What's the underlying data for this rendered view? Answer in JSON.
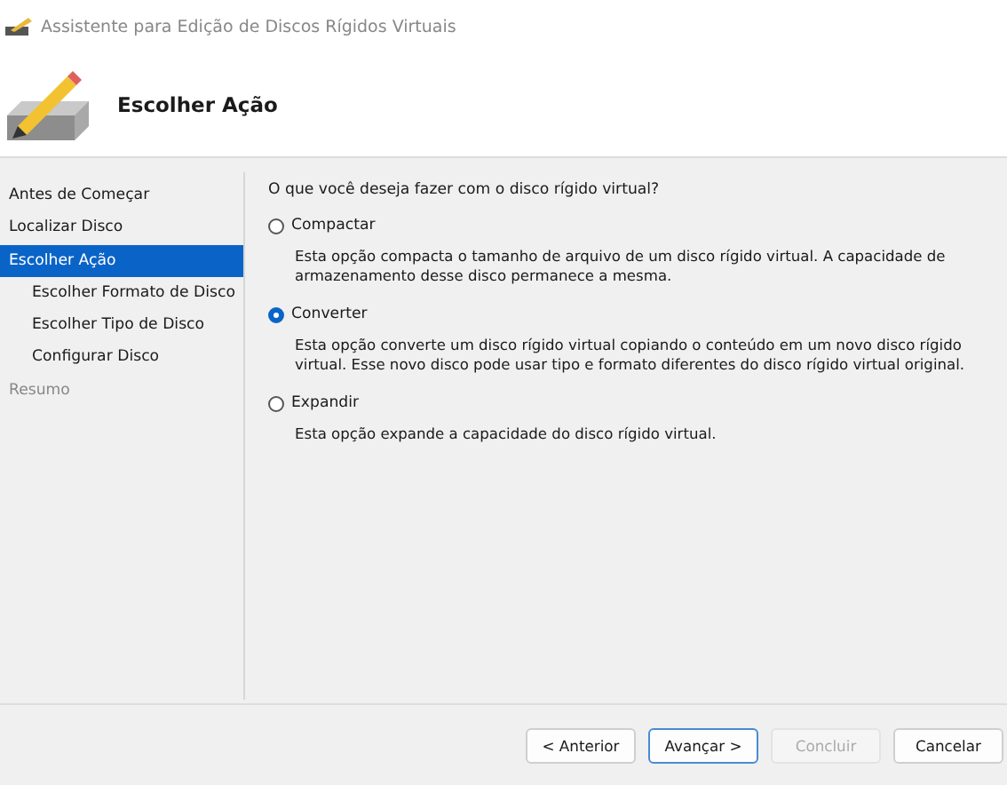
{
  "window": {
    "title": "Assistente para Edição de Discos Rígidos Virtuais"
  },
  "header": {
    "title": "Escolher Ação"
  },
  "sidebar": {
    "items": [
      {
        "label": "Antes de Começar",
        "selected": false,
        "disabled": false
      },
      {
        "label": "Localizar Disco",
        "selected": false,
        "disabled": false
      },
      {
        "label": "Escolher Ação",
        "selected": true,
        "disabled": false,
        "children": [
          {
            "label": "Escolher Formato de Disco",
            "selected": false,
            "disabled": false
          },
          {
            "label": "Escolher Tipo de Disco",
            "selected": false,
            "disabled": false
          },
          {
            "label": "Configurar Disco",
            "selected": false,
            "disabled": false
          }
        ]
      },
      {
        "label": "Resumo",
        "selected": false,
        "disabled": true
      }
    ]
  },
  "content": {
    "question": "O que você deseja fazer com o disco rígido virtual?",
    "options": [
      {
        "label": "Compactar",
        "selected": false,
        "description": "Esta opção compacta o tamanho de arquivo de um disco rígido virtual. A capacidade de armazenamento desse disco permanece a mesma."
      },
      {
        "label": "Converter",
        "selected": true,
        "description": "Esta opção converte um disco rígido virtual copiando o conteúdo em um novo disco rígido virtual. Esse novo disco pode usar tipo e formato diferentes do disco rígido virtual original."
      },
      {
        "label": "Expandir",
        "selected": false,
        "description": "Esta opção expande a capacidade do disco rígido virtual."
      }
    ]
  },
  "buttons": [
    {
      "label": "< Anterior",
      "default": false,
      "disabled": false
    },
    {
      "label": "Avançar >",
      "default": true,
      "disabled": false
    },
    {
      "label": "Concluir",
      "default": false,
      "disabled": true
    },
    {
      "label": "Cancelar",
      "default": false,
      "disabled": false
    }
  ]
}
